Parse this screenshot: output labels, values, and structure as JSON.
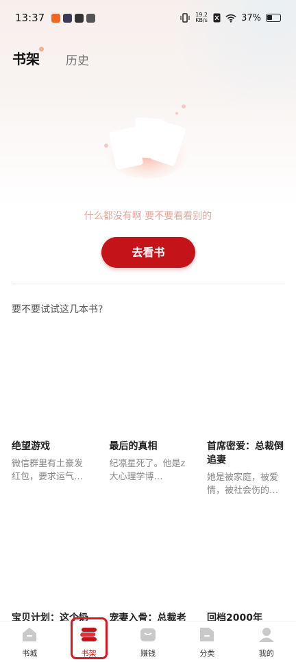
{
  "status_bar": {
    "time": "13:37",
    "net_speed_value": "19.2",
    "net_speed_unit": "KB/s",
    "battery": "37%"
  },
  "header": {
    "tab_active": "书架",
    "tab_inactive": "历史"
  },
  "empty_state": {
    "message": "什么都没有啊 要不要看看别的",
    "button_label": "去看书"
  },
  "recommend": {
    "title": "要不要试试这几本书?",
    "books": [
      {
        "title": "绝望游戏",
        "desc": "微信群里有土豪发红包，要求运气…"
      },
      {
        "title": "最后的真相",
        "desc": "纪凛星死了。他是z大心理学博…"
      },
      {
        "title": "首席密爱：总裁倒追妻",
        "desc": "她是被家庭，被爱情，被社会伤的…"
      }
    ],
    "books_row2": [
      {
        "title": "宝贝计划：这个奶"
      },
      {
        "title": "宠妻入骨：总裁老"
      },
      {
        "title": "回档2000年"
      }
    ]
  },
  "bottom_nav": {
    "items": [
      {
        "label": "书城",
        "icon": "bookstore-icon"
      },
      {
        "label": "书架",
        "icon": "bookshelf-icon"
      },
      {
        "label": "赚钱",
        "icon": "wallet-icon"
      },
      {
        "label": "分类",
        "icon": "category-icon"
      },
      {
        "label": "我的",
        "icon": "profile-icon"
      }
    ],
    "active_index": 1,
    "accent_color": "#c4141a"
  }
}
